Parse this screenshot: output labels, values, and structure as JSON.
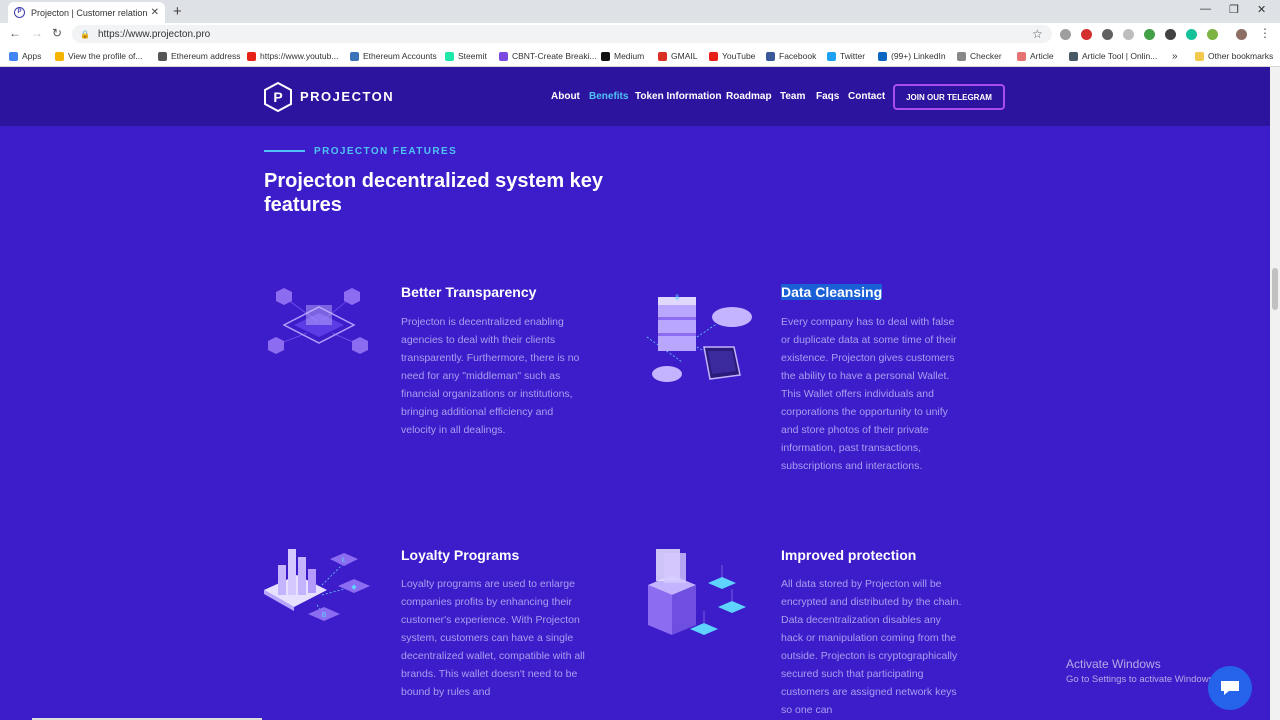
{
  "browser": {
    "tab_title": "Projecton | Customer relationship",
    "url": "https://www.projecton.pro",
    "bookmarks": [
      {
        "label": "Apps",
        "color": "#4285f4"
      },
      {
        "label": "View the profile of...",
        "color": "#f4b400"
      },
      {
        "label": "Ethereum address",
        "color": "#555555"
      },
      {
        "label": "https://www.youtub...",
        "color": "#e62117"
      },
      {
        "label": "Ethereum Accounts",
        "color": "#3b73b9"
      },
      {
        "label": "Steemit",
        "color": "#1ee8a9"
      },
      {
        "label": "CBNT-Create Breaki...",
        "color": "#7b4ae2"
      },
      {
        "label": "Medium",
        "color": "#111111"
      },
      {
        "label": "GMAIL",
        "color": "#d93025"
      },
      {
        "label": "YouTube",
        "color": "#e62117"
      },
      {
        "label": "Facebook",
        "color": "#3b5998"
      },
      {
        "label": "Twitter",
        "color": "#1da1f2"
      },
      {
        "label": "(99+) LinkedIn",
        "color": "#0a66c2"
      },
      {
        "label": "Checker",
        "color": "#888888"
      },
      {
        "label": "Article",
        "color": "#e57373"
      },
      {
        "label": "Article Tool | Onlin...",
        "color": "#455a64"
      }
    ],
    "other_bookmarks": "Other bookmarks"
  },
  "site": {
    "logo_text": "PROJECTON",
    "nav": [
      "About",
      "Benefits",
      "Token Information",
      "Roadmap",
      "Team",
      "Faqs",
      "Contact"
    ],
    "active_nav": "Benefits",
    "cta": "JOIN OUR TELEGRAM"
  },
  "section": {
    "kicker": "PROJECTON FEATURES",
    "headline": "Projecton decentralized system key features"
  },
  "features": [
    {
      "title": "Better Transparency",
      "body": "Projecton is decentralized enabling agencies to deal with their clients transparently. Furthermore, there is no need for any \"middleman\" such as financial organizations or institutions, bringing additional efficiency and velocity in all dealings.",
      "icon": "transparency-illustration-icon"
    },
    {
      "title": "Data Cleansing",
      "body": "Every company has to deal with false or duplicate data at some time of their existence. Projecton gives customers the ability to have a personal Wallet. This Wallet offers individuals and corporations the opportunity to unify and store photos of their private information, past transactions, subscriptions and interactions.",
      "icon": "data-cleansing-illustration-icon"
    },
    {
      "title": "Loyalty Programs",
      "body": "Loyalty programs are used to enlarge companies profits by enhancing their customer's experience. With Projecton system, customers can have a single decentralized wallet, compatible with all brands. This wallet doesn't need to be bound by rules and",
      "icon": "loyalty-illustration-icon"
    },
    {
      "title": "Improved protection",
      "body": "All data stored by Projecton will be encrypted and distributed by the chain. Data decentralization disables any hack or manipulation coming from the outside. Projecton is cryptographically secured such that participating customers are assigned network keys so one can",
      "icon": "protection-illustration-icon"
    }
  ],
  "watermark": {
    "line1": "Activate Windows",
    "line2": "Go to Settings to activate Windows."
  }
}
